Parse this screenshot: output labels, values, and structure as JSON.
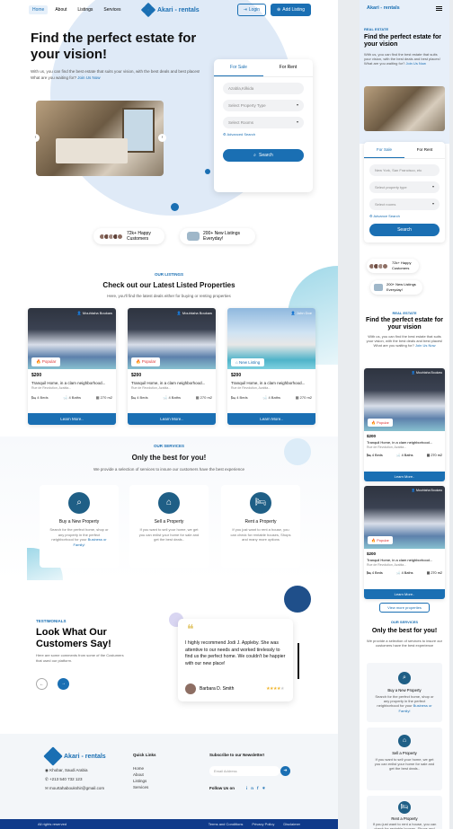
{
  "nav": {
    "links": [
      "Home",
      "About",
      "Listings",
      "Services"
    ],
    "brand": "Akari - rentals",
    "login": "Login",
    "add_listing": "Add Listing"
  },
  "hero": {
    "title": "Find the perfect estate for your vision!",
    "subtitle": "With us, you can find the best estate that suits your vision, with the best deals and best places! What are you waiting for?",
    "join": "Join Us Now",
    "search": {
      "tab_sale": "For Sale",
      "tab_rent": "For Rent",
      "location_placeholder": "Azabla,Kilkida",
      "property_type": "Select Property Type",
      "rooms": "Select Rooms",
      "advanced": "Advanced Search",
      "button": "Search"
    }
  },
  "stats": {
    "customers": "72k+ Happy Customers",
    "listings": "200+ New Listings Everyday!"
  },
  "listings": {
    "label": "OUR LISTINGS",
    "title": "Check out our Latest Listed Properties",
    "subtitle": "Here, you'll find the latest deals either for buying or renting properties",
    "cards": [
      {
        "owner": "Mouhtaha Boukaw",
        "badge": "Popular",
        "price": "$200",
        "desc": "Tranquil Home, in a clam neighborhood...",
        "addr": "Rue de Revolution, Azabla...",
        "beds": "4 Beds",
        "baths": "4 Baths",
        "area": "270 m2",
        "more": "Learn More.."
      },
      {
        "owner": "Mouhtaha Boukaw",
        "badge": "Popular",
        "price": "$200",
        "desc": "Tranquil Home, in a clam neighborhood...",
        "addr": "Rue de Revolution, Azabla...",
        "beds": "4 Beds",
        "baths": "4 Baths",
        "area": "270 m2",
        "more": "Learn More.."
      },
      {
        "owner": "John Doe",
        "badge": "New Listing",
        "price": "$200",
        "desc": "Tranquil Home, in a clam neighborhood...",
        "addr": "Rue de Revolution, Azabla...",
        "beds": "4 Beds",
        "baths": "4 Baths",
        "area": "270 m2",
        "more": "Learn More.."
      }
    ]
  },
  "services": {
    "label": "OUR SERVICES",
    "title": "Only the best for you!",
    "subtitle": "We provide a selection of services to insure our customers have the best experience",
    "items": [
      {
        "title": "Buy a New Property",
        "desc": "Search for the perfect home, shop or any property in the perfect neighborhood for your",
        "tail": "Business or Family!"
      },
      {
        "title": "Sell a Property",
        "desc": "If you want to sell your home, we get you can enlist your home for sale and get the best deals..",
        "tail": ""
      },
      {
        "title": "Rent a Property",
        "desc": "If you just want to rent a house, you can check for rentable houses, Shops and many more options",
        "tail": ""
      }
    ]
  },
  "testimonials": {
    "label": "TESTIMONIALS",
    "title": "Look What Our Customers Say!",
    "subtitle": "Here are some comments from some of the Costumers that used our platform.",
    "quote": "I highly recommend Jodi J. Appleby. She was attentive to our needs and worked tirelessly to find us the perfect home. We couldn't be happier with our new place!",
    "author": "Barbara D. Smith",
    "rating": 4
  },
  "footer": {
    "address": "Khobar, Saudi Arabia",
    "phone": "+213 540 732 123",
    "email": "mourtahaboukshir@gmail.com",
    "quick_links_title": "Quick Links",
    "quick_links": [
      "Home",
      "About",
      "Listings",
      "Services"
    ],
    "newsletter_title": "Subscribe to our Newsletter!",
    "email_placeholder": "Email Address",
    "follow": "Follow Us on",
    "copyright": "All rights reserved",
    "terms": "Terms and Conditions",
    "privacy": "Privacy Policy",
    "disclaimer": "Disclaimer"
  },
  "mobile": {
    "brand": "Akari - rentals",
    "label": "REAL ESTATE",
    "title": "Find the perfect estate for your vision",
    "subtitle": "With us, you can find the best estate that suits your vision, with the best deals and best places! What are you waiting for?",
    "join": "Join Us Now",
    "tab_sale": "For Sale",
    "tab_rent": "For Rent",
    "location_placeholder": "New York, San Francisco, etc",
    "property_type": "Select property type",
    "rooms": "Select rooms",
    "advanced": "Advance Search",
    "search": "Search",
    "customers": "72k+ Happy Customers",
    "listings": "200+ New Listings Everyday!",
    "label2": "REAL ESTATE",
    "title2": "Find the perfect estate for your vision",
    "view_more": "View more properties",
    "services_label": "OUR SERVICES",
    "services_title": "Only the best for you!",
    "services_sub": "We provide a selection of services to insure our customers have the best experience"
  }
}
